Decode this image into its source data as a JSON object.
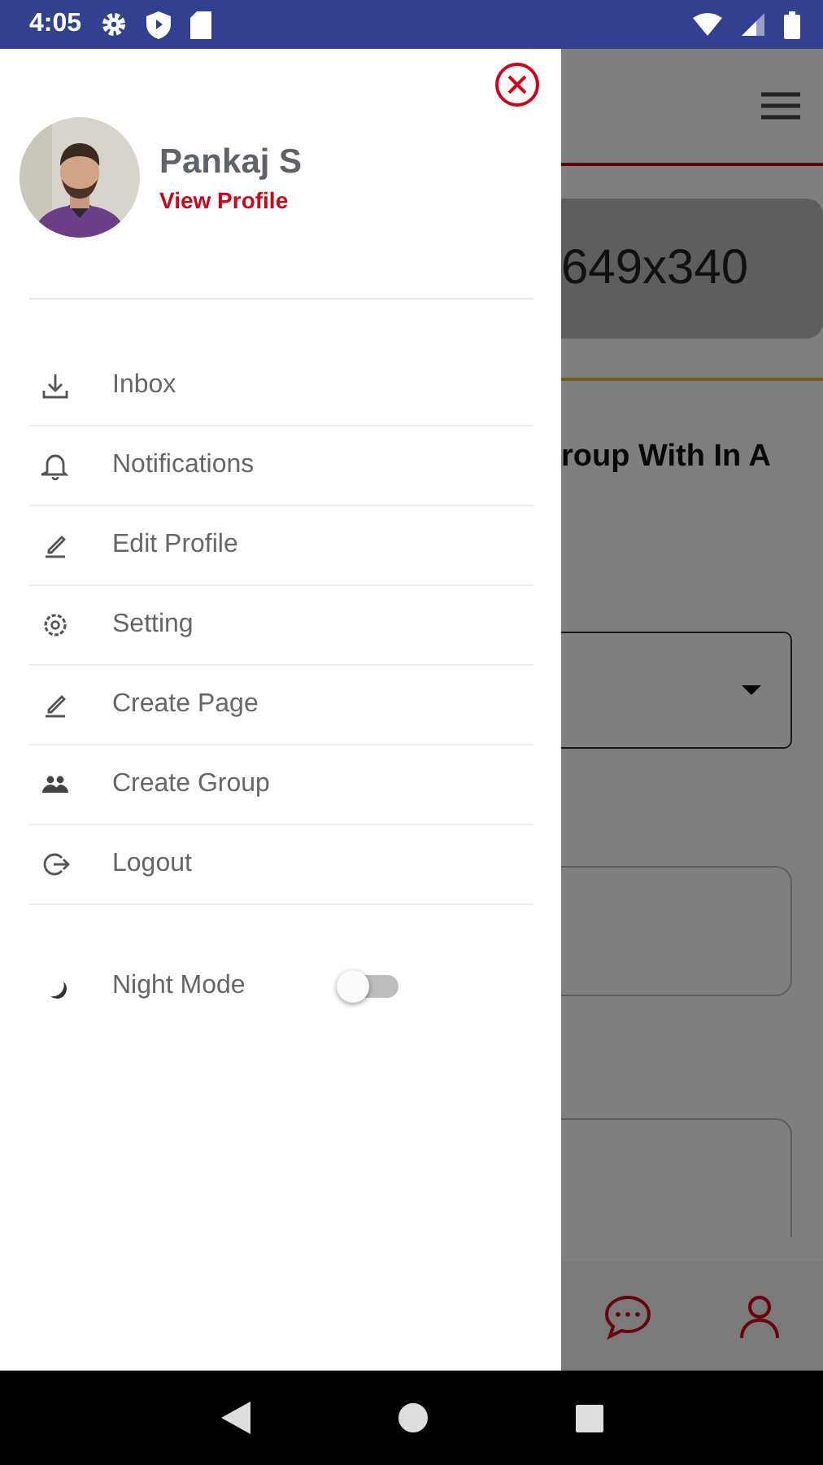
{
  "status_bar": {
    "time": "4:05"
  },
  "background": {
    "image_placeholder": "649x340",
    "heading": "roup With In A"
  },
  "drawer": {
    "profile": {
      "name": "Pankaj S",
      "link": "View Profile"
    },
    "menu": [
      {
        "label": "Inbox"
      },
      {
        "label": "Notifications"
      },
      {
        "label": "Edit Profile"
      },
      {
        "label": "Setting"
      },
      {
        "label": "Create Page"
      },
      {
        "label": "Create Group"
      },
      {
        "label": "Logout"
      }
    ],
    "night_mode": {
      "label": "Night Mode",
      "on": false
    }
  }
}
